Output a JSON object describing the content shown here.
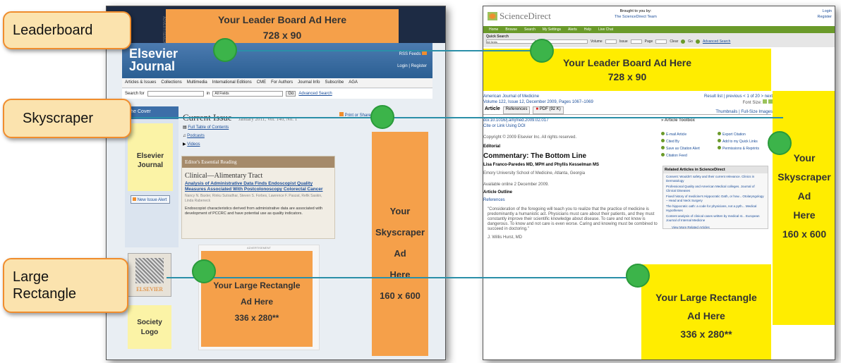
{
  "callouts": {
    "leaderboard": "Leaderboard",
    "skyscraper": "Skyscraper",
    "large_rectangle_l1": "Large",
    "large_rectangle_l2": "Rectangle"
  },
  "left_page": {
    "advertisement": "ADVERTISEMENT",
    "leader_ad": {
      "line1": "Your Leader Board Ad Here",
      "line2": "728 x 90"
    },
    "logo_line1": "Elsevier",
    "logo_line2": "Journal",
    "rss": "RSS Feeds",
    "login": "Login | Register",
    "nav": [
      "Articles & Issues",
      "Collections",
      "Multimedia",
      "International Editions",
      "CME",
      "For Authors",
      "Journal Info",
      "Subscribe",
      "AGA"
    ],
    "search_for": "Search for",
    "search_in": "in",
    "all_fields": "All Fields",
    "go": "Go",
    "advanced_search": "Advanced Search",
    "the_cover": "The Cover",
    "journal_name_l1": "Elsevier",
    "journal_name_l2": "Journal",
    "new_issue_alert": "New Issue Alert",
    "current_issue": "Current Issue",
    "issue_date": "January 2011, Vol. 140, No. 1",
    "print_share": "Print or Share This Page",
    "toc_links": [
      "Full Table of Contents",
      "Podcasts",
      "Videos"
    ],
    "reading_box_title": "Editor's Essential Reading",
    "section_title": "Clinical—Alimentary Tract",
    "article_title": "Analysis of Administrative Data Finds Endoscopist Quality Measures Associated With Postcolonoscopy Colorectal Cancer",
    "authors": "Nancy N. Baxter, Rinku Sutradhar, Steven S. Forbes, Lawrence F. Paszat, Refik Saskin, Linda Rabeneck",
    "summary": "Endoscopist characteristics derived from administrative data are associated with development of PCCRC and have potential use as quality indicators.",
    "elsevier_logo": "ELSEVIER",
    "society_logo_l1": "Society",
    "society_logo_l2": "Logo",
    "large_rect": {
      "line1": "Your Large Rectangle",
      "line2": "Ad Here",
      "line3": "336 x 280**"
    },
    "skyscraper": {
      "line1": "Your",
      "line2": "Skyscraper",
      "line3": "Ad",
      "line4": "Here",
      "line5": "160 x 600"
    }
  },
  "right_page": {
    "logo": "ScienceDirect",
    "brought_l1": "Brought to you by:",
    "brought_l2": "The ScienceDirect Team",
    "login_l1": "Login",
    "login_l2": "Register",
    "nav": [
      "Home",
      "Browse",
      "Search",
      "My Settings",
      "Alerts",
      "Help",
      "Live Chat"
    ],
    "quick_search": "Quick Search",
    "all_fields": "All fields",
    "author": "Author",
    "volume": "Volume",
    "issue": "Issue",
    "page": "Page",
    "clear": "Clear",
    "go": "Go",
    "advanced_search": "Advanced Search",
    "leader_ad": {
      "line1": "Your Leader Board Ad Here",
      "line2": "728 x 90"
    },
    "journal": "American Journal of Medicine",
    "volume_info": "Volume 122, Issue 12, December 2009, Pages 1067–1069",
    "results": "Result list | previous < 1 of 20 > next",
    "font_size": "Font Size:",
    "tabs": [
      "Article",
      "References",
      "PDF (92 K)"
    ],
    "thumbnails": "Thumbnails | Full-Size Images",
    "doi": "doi:10.1016/j.amjmed.2009.02.017",
    "cite": "Cite or Link Using DOI",
    "copyright": "Copyright © 2009 Elsevier Inc. All rights reserved.",
    "editorial": "Editorial",
    "article_title": "Commentary: The Bottom Line",
    "article_authors": "Lisa Franco-Paredes MD, MPH and Phyllis Kesselman MS",
    "affiliation": "Emory University School of Medicine, Atlanta, Georgia",
    "available": "Available online 2 December 2009.",
    "article_outline": "Article Outline",
    "references": "References",
    "quote": "\"Consideration of the foregoing will teach you to realize that the practice of medicine is predominantly a humanistic act. Physicians must care about their patients, and they must constantly improve their scientific knowledge about disease. To care and not know is dangerous. To know and not care is even worse. Caring and knowing must be combined to succeed in doctoring.\"",
    "quote_author": "J. Willis Hurst, MD",
    "features_title": "» Article Toolbox",
    "features": [
      "E-mail Article",
      "Export Citation",
      "Cited By",
      "Add to my Quick Links",
      "Save as Citation Alert",
      "Permissions & Reprints",
      "Citation Feed"
    ],
    "related_title": "Related Articles in ScienceDirect",
    "related": [
      "Consent: Wouldn't safety and their current relevance. Clinics in Dermatology",
      "Professional Quality and American Medical colleges. Journal of Clinical Diseases",
      "Fixed history of medicine's Hippocratic Oath, or how... Otolaryngology – Head and Neck Surgery",
      "The hippocratic oath: a code for physicians, not a pyth... Medical Hypotheses",
      "Content analysis of clinical cases written by medical st... European Journal of Internal Medicine"
    ],
    "view_more": "View More Related Articles",
    "skyscraper": {
      "line1": "Your",
      "line2": "Skyscraper",
      "line3": "Ad",
      "line4": "Here",
      "line5": "160 x 600"
    },
    "large_rect": {
      "line1": "Your Large Rectangle",
      "line2": "Ad Here",
      "line3": "336 x 280**"
    }
  },
  "colors": {
    "orange_ad": "#f5a04a",
    "yellow_ad": "#ffed00",
    "marker": "#3cb44a",
    "connector": "#2a8fa8",
    "callout_fill": "#fbe3ae",
    "callout_border": "#f08d2d",
    "elsevier_header": "#2b5f93",
    "sd_nav": "#6a9a2a"
  }
}
